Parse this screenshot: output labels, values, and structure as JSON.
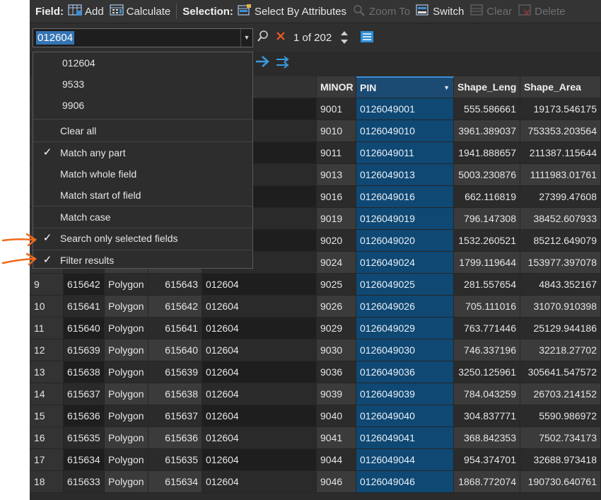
{
  "toolbar": {
    "field_label": "Field:",
    "add_label": "Add",
    "calculate_label": "Calculate",
    "selection_label": "Selection:",
    "select_by_attributes_label": "Select By Attributes",
    "zoom_to_label": "Zoom To",
    "switch_label": "Switch",
    "clear_label": "Clear",
    "delete_label": "Delete"
  },
  "search": {
    "value": "012604",
    "count_text": "1 of 202"
  },
  "dropdown": {
    "values": [
      "012604",
      "9533",
      "9906"
    ],
    "clear_all": "Clear all",
    "match_any_part": "Match any part",
    "match_whole_field": "Match whole field",
    "match_start_of_field": "Match start of field",
    "match_case": "Match case",
    "search_only_selected": "Search only selected fields",
    "filter_results": "Filter results"
  },
  "table": {
    "columns": [
      "MINOR",
      "PIN",
      "Shape_Leng",
      "Shape_Area"
    ],
    "rows": [
      {
        "idx": "",
        "oid": "",
        "shape": "",
        "fid": "",
        "major": "",
        "minor": "9001",
        "pin": "0126049001",
        "len": "555.586661",
        "area": "19173.546175"
      },
      {
        "idx": "",
        "oid": "",
        "shape": "",
        "fid": "",
        "major": "",
        "minor": "9010",
        "pin": "0126049010",
        "len": "3961.389037",
        "area": "753353.203564"
      },
      {
        "idx": "",
        "oid": "",
        "shape": "",
        "fid": "",
        "major": "",
        "minor": "9011",
        "pin": "0126049011",
        "len": "1941.888657",
        "area": "211387.115644"
      },
      {
        "idx": "",
        "oid": "",
        "shape": "",
        "fid": "",
        "major": "",
        "minor": "9013",
        "pin": "0126049013",
        "len": "5003.230876",
        "area": "1111983.01761"
      },
      {
        "idx": "",
        "oid": "",
        "shape": "",
        "fid": "",
        "major": "",
        "minor": "9016",
        "pin": "0126049016",
        "len": "662.116819",
        "area": "27399.47608"
      },
      {
        "idx": "",
        "oid": "",
        "shape": "",
        "fid": "",
        "major": "",
        "minor": "9019",
        "pin": "0126049019",
        "len": "796.147308",
        "area": "38452.607933"
      },
      {
        "idx": "",
        "oid": "",
        "shape": "",
        "fid": "",
        "major": "",
        "minor": "9020",
        "pin": "0126049020",
        "len": "1532.260521",
        "area": "85212.649079"
      },
      {
        "idx": "",
        "oid": "",
        "shape": "",
        "fid": "",
        "major": "",
        "minor": "9024",
        "pin": "0126049024",
        "len": "1799.119644",
        "area": "153977.397078"
      },
      {
        "idx": "9",
        "oid": "615642",
        "shape": "Polygon",
        "fid": "615643",
        "major": "012604",
        "minor": "9025",
        "pin": "0126049025",
        "len": "281.557654",
        "area": "4843.352167"
      },
      {
        "idx": "10",
        "oid": "615641",
        "shape": "Polygon",
        "fid": "615642",
        "major": "012604",
        "minor": "9026",
        "pin": "0126049026",
        "len": "705.111016",
        "area": "31070.910398"
      },
      {
        "idx": "11",
        "oid": "615640",
        "shape": "Polygon",
        "fid": "615641",
        "major": "012604",
        "minor": "9029",
        "pin": "0126049029",
        "len": "763.771446",
        "area": "25129.944186"
      },
      {
        "idx": "12",
        "oid": "615639",
        "shape": "Polygon",
        "fid": "615640",
        "major": "012604",
        "minor": "9030",
        "pin": "0126049030",
        "len": "746.337196",
        "area": "32218.27702"
      },
      {
        "idx": "13",
        "oid": "615638",
        "shape": "Polygon",
        "fid": "615639",
        "major": "012604",
        "minor": "9036",
        "pin": "0126049036",
        "len": "3250.125961",
        "area": "305641.547572"
      },
      {
        "idx": "14",
        "oid": "615637",
        "shape": "Polygon",
        "fid": "615638",
        "major": "012604",
        "minor": "9039",
        "pin": "0126049039",
        "len": "784.043259",
        "area": "26703.214152"
      },
      {
        "idx": "15",
        "oid": "615636",
        "shape": "Polygon",
        "fid": "615637",
        "major": "012604",
        "minor": "9040",
        "pin": "0126049040",
        "len": "304.837771",
        "area": "5590.986972"
      },
      {
        "idx": "16",
        "oid": "615635",
        "shape": "Polygon",
        "fid": "615636",
        "major": "012604",
        "minor": "9041",
        "pin": "0126049041",
        "len": "368.842353",
        "area": "7502.734173"
      },
      {
        "idx": "17",
        "oid": "615634",
        "shape": "Polygon",
        "fid": "615635",
        "major": "012604",
        "minor": "9044",
        "pin": "0126049044",
        "len": "954.374701",
        "area": "32688.973418"
      },
      {
        "idx": "18",
        "oid": "615633",
        "shape": "Polygon",
        "fid": "615634",
        "major": "012604",
        "minor": "9046",
        "pin": "0126049046",
        "len": "1868.772074",
        "area": "190730.640761"
      }
    ]
  },
  "colors": {
    "background": "#2b2b2b",
    "accent": "#3a90d8",
    "pin_column": "#0f4873",
    "annotation_arrow": "#f06a1c"
  },
  "icons": [
    "add-field-icon",
    "calculate-icon",
    "select-by-attributes-icon",
    "zoom-to-icon",
    "switch-icon",
    "clear-icon",
    "delete-icon",
    "search-icon",
    "clear-search-icon",
    "up-down-icon",
    "options-menu-icon",
    "next-arrow-icon",
    "swap-arrows-icon",
    "checkmark-icon",
    "annotation-arrow-icon"
  ]
}
